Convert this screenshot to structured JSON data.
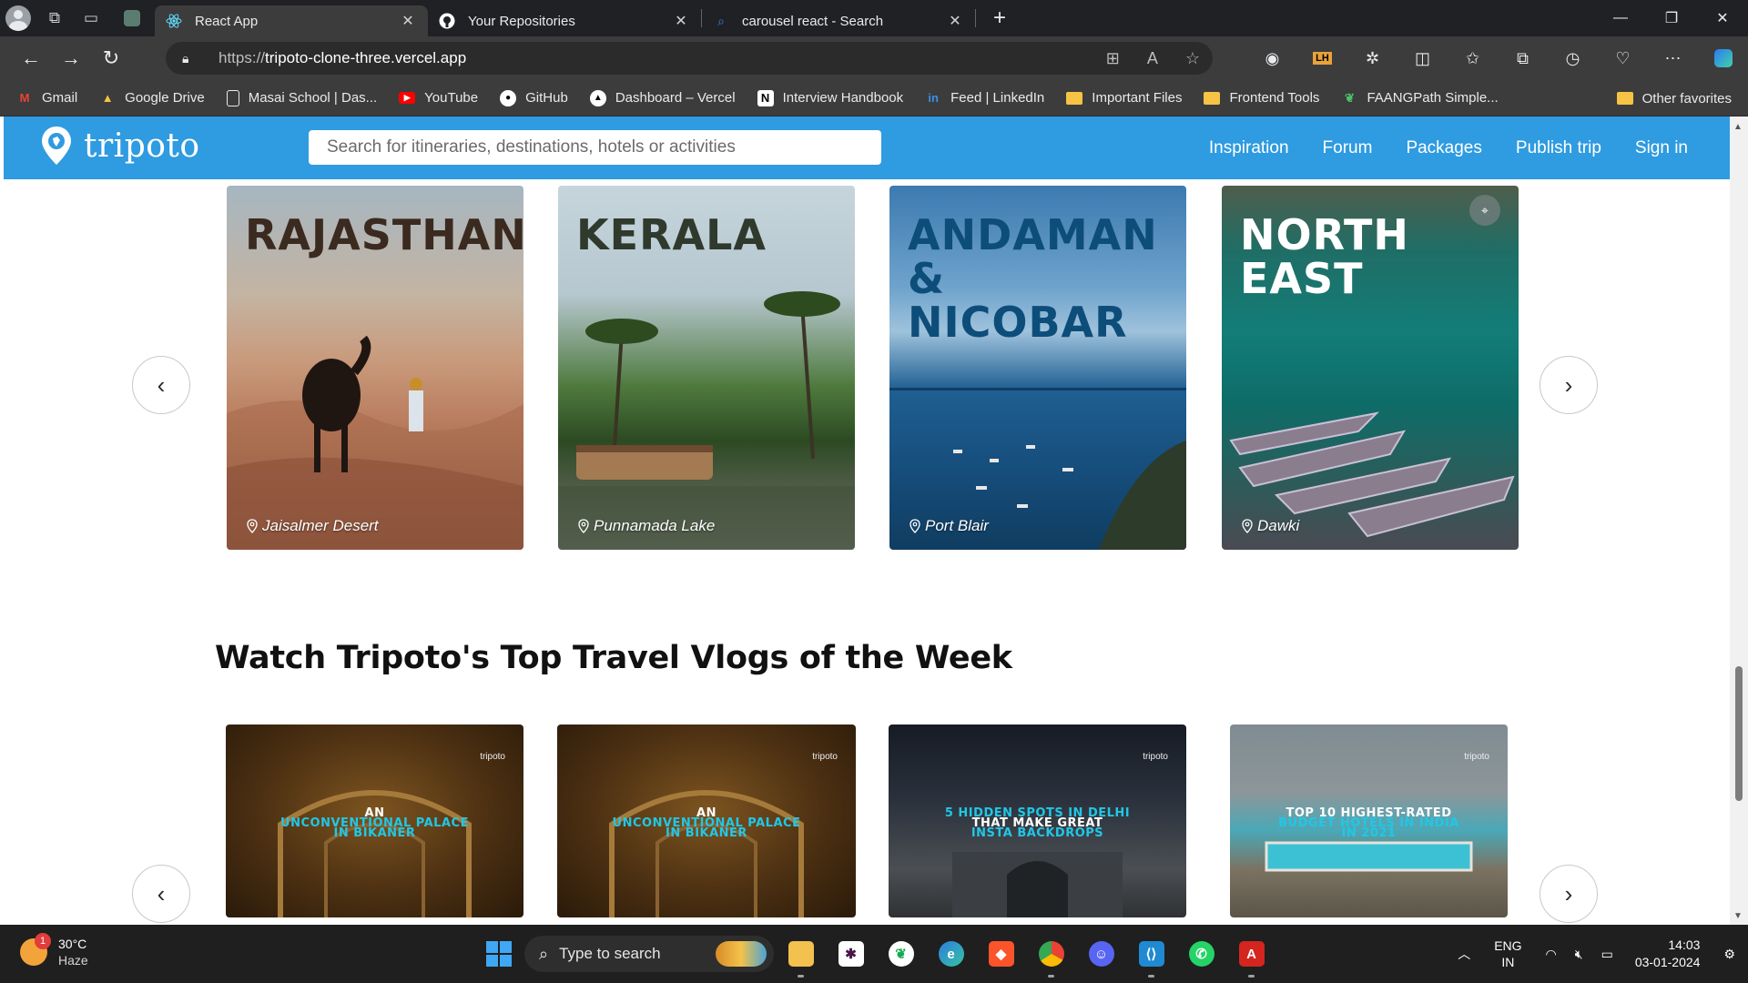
{
  "browser": {
    "tabs": [
      {
        "title": "React App",
        "icon": "react-icon",
        "active": true
      },
      {
        "title": "Your Repositories",
        "icon": "github-icon",
        "active": false
      },
      {
        "title": "carousel react - Search",
        "icon": "search-icon",
        "active": false
      }
    ],
    "url_protocol": "https://",
    "url_host": "tripoto-clone-three.vercel.app",
    "bookmarks": [
      {
        "label": "Gmail",
        "icon": "gmail-icon"
      },
      {
        "label": "Google Drive",
        "icon": "google-drive-icon"
      },
      {
        "label": "Masai School | Das...",
        "icon": "page-icon"
      },
      {
        "label": "YouTube",
        "icon": "youtube-icon"
      },
      {
        "label": "GitHub",
        "icon": "github-icon"
      },
      {
        "label": "Dashboard – Vercel",
        "icon": "vercel-icon"
      },
      {
        "label": "Interview Handbook",
        "icon": "notion-icon"
      },
      {
        "label": "Feed | LinkedIn",
        "icon": "linkedin-icon"
      },
      {
        "label": "Important Files",
        "icon": "folder-icon"
      },
      {
        "label": "Frontend Tools",
        "icon": "folder-icon"
      },
      {
        "label": "FAANGPath Simple...",
        "icon": "leaf-icon"
      }
    ],
    "other_favorites": "Other favorites"
  },
  "site": {
    "logo": "tripoto",
    "search_placeholder": "Search for itineraries, destinations, hotels or activities",
    "nav": [
      "Inspiration",
      "Forum",
      "Packages",
      "Publish trip",
      "Sign in"
    ],
    "accent_color": "#2f9be0"
  },
  "destinations": [
    {
      "title": "RAJASTHAN",
      "location": "Jaisalmer Desert",
      "title_color": "#3b2a20"
    },
    {
      "title": "KERALA",
      "location": "Punnamada Lake",
      "title_color": "#2f3a2d"
    },
    {
      "title": "ANDAMAN & NICOBAR",
      "location": "Port Blair",
      "title_color": "#0d4d7a"
    },
    {
      "title": "NORTH EAST",
      "location": "Dawki",
      "title_color": "#ffffff"
    }
  ],
  "vlogs_section": {
    "title": "Watch Tripoto's Top Travel Vlogs of the Week",
    "brand": "tripoto",
    "vlogs": [
      {
        "line1": "AN",
        "line2": "UNCONVENTIONAL PALACE",
        "line3": "IN BIKANER"
      },
      {
        "line1": "AN",
        "line2": "UNCONVENTIONAL PALACE",
        "line3": "IN BIKANER"
      },
      {
        "line1": "5 HIDDEN SPOTS IN DELHI",
        "line2": "THAT MAKE GREAT",
        "line3": "INSTA BACKDROPS"
      },
      {
        "line1": "TOP 10 HIGHEST-RATED",
        "line2": "BUDGET HOTELS IN INDIA",
        "line3": "IN 2021"
      }
    ]
  },
  "taskbar": {
    "temperature": "30°C",
    "condition": "Haze",
    "notification_count": "1",
    "search_placeholder": "Type to search",
    "lang_line1": "ENG",
    "lang_line2": "IN",
    "time": "14:03",
    "date": "03-01-2024"
  }
}
